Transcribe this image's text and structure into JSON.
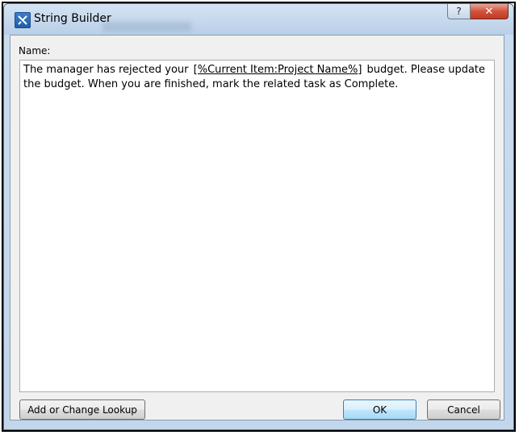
{
  "window": {
    "title": "String Builder",
    "help_glyph": "?",
    "close_glyph": "✕"
  },
  "form": {
    "name_label": "Name:",
    "text_before": "The manager has rejected your ",
    "lookup_token": "[%Current Item:Project Name%]",
    "text_after": " budget. Please update the budget. When you are finished, mark the related task as Complete."
  },
  "buttons": {
    "lookup": "Add or Change Lookup",
    "ok": "OK",
    "cancel": "Cancel"
  },
  "icons": {
    "app": "tools-icon",
    "help": "help-icon",
    "close": "close-icon"
  }
}
